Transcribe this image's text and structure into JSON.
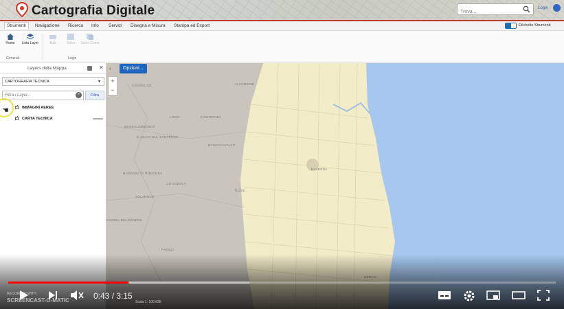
{
  "header": {
    "title": "Cartografia Digitale",
    "search_placeholder": "Trova...",
    "login": "Login"
  },
  "menu": {
    "tabs": [
      "Strumenti",
      "Navigazione",
      "Ricerca",
      "Info",
      "Servizi",
      "Disegna e Misura",
      "Stampa ed Export"
    ],
    "active": "Strumenti",
    "toggle_label": "Etichette Strumenti"
  },
  "ribbon": {
    "buttons": [
      {
        "label": "Home",
        "icon": "home-icon",
        "enabled": true
      },
      {
        "label": "Lista Layer",
        "icon": "layers-icon",
        "enabled": true
      },
      {
        "label": "Mail",
        "icon": "mail-icon",
        "enabled": false
      },
      {
        "label": "Salva",
        "icon": "save-icon",
        "enabled": false
      },
      {
        "label": "Salva Come",
        "icon": "save-as-icon",
        "enabled": false
      }
    ],
    "groups": [
      "Generali",
      "Login"
    ]
  },
  "sidebar": {
    "title": "Layers della Mappa",
    "select_value": "CARTOGRAFIA TECNICA",
    "filter_placeholder": "Filtra i Layer...",
    "filter_button": "Filtra",
    "layers": [
      {
        "name": "IMMAGINI AEREE",
        "checked": true
      },
      {
        "name": "CARTA TECNICA",
        "checked": true
      }
    ]
  },
  "map": {
    "options_button": "Opzioni...",
    "places": [
      "CONSELICE",
      "ALFONSINE",
      "LUGO",
      "FUSIGNANO",
      "MASSALOMBARDA",
      "S.AGATA SUL SANTERNO",
      "BAGNACAVALLO",
      "BAGNARA DI ROMAGNA",
      "COTIGNOLA",
      "SOLAROLO",
      "CASTEL BOLOGNESE",
      "RUSSI",
      "FAENZA",
      "RAVENNA",
      "CERVIA"
    ],
    "scale_label": "Scala 1:",
    "scale_value": "100.628"
  },
  "video": {
    "time": "0:43 / 3:15",
    "played_fraction": 0.22,
    "buffered_fraction": 0.44,
    "watermark": "SCREENCAST-O-MATIC"
  }
}
